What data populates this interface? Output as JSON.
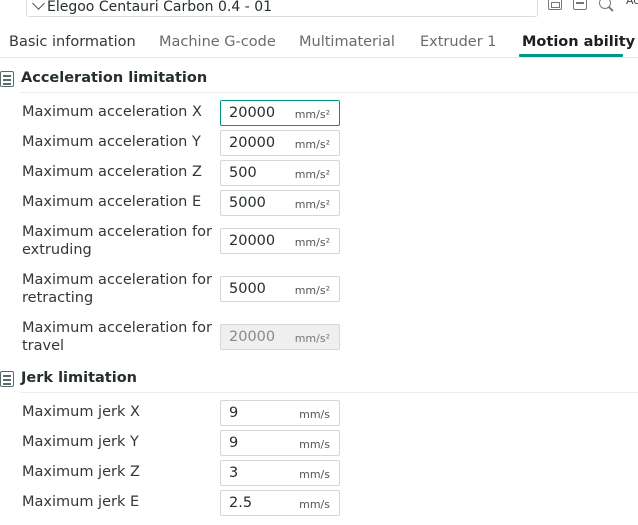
{
  "preset": {
    "name": "Elegoo Centauri Carbon 0.4 - 01",
    "adv_label": "Ad"
  },
  "tabs": [
    {
      "label": "Basic information",
      "active": false
    },
    {
      "label": "Machine G-code",
      "active": false
    },
    {
      "label": "Multimaterial",
      "active": false
    },
    {
      "label": "Extruder 1",
      "active": false
    },
    {
      "label": "Motion ability",
      "active": true
    }
  ],
  "accent_color": "#009688",
  "acceleration": {
    "title": "Acceleration limitation",
    "unit": "mm/s²",
    "rows": [
      {
        "label": "Maximum acceleration X",
        "value": "20000"
      },
      {
        "label": "Maximum acceleration Y",
        "value": "20000"
      },
      {
        "label": "Maximum acceleration Z",
        "value": "500"
      },
      {
        "label": "Maximum acceleration E",
        "value": "5000"
      },
      {
        "label": "Maximum acceleration for extruding",
        "value": "20000"
      },
      {
        "label": "Maximum acceleration for retracting",
        "value": "5000"
      },
      {
        "label": "Maximum acceleration for travel",
        "value": "20000",
        "disabled": true
      }
    ]
  },
  "jerk": {
    "title": "Jerk limitation",
    "unit": "mm/s",
    "rows": [
      {
        "label": "Maximum jerk X",
        "value": "9"
      },
      {
        "label": "Maximum jerk Y",
        "value": "9"
      },
      {
        "label": "Maximum jerk Z",
        "value": "3"
      },
      {
        "label": "Maximum jerk E",
        "value": "2.5"
      }
    ]
  }
}
